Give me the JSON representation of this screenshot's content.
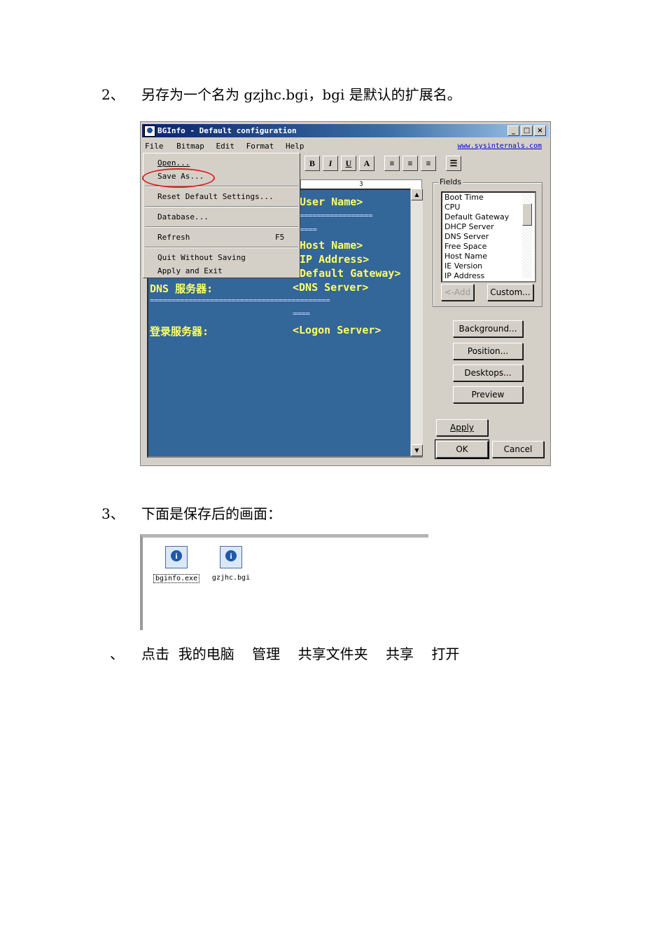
{
  "steps": [
    {
      "number": "2、",
      "text": "另存为一个名为 gzjhc.bgi，bgi 是默认的扩展名。"
    },
    {
      "number": "3、",
      "text": "下面是保存后的画面："
    },
    {
      "number": "、",
      "text": "点击  我的电脑    管理    共享文件夹    共享    打开"
    }
  ],
  "bginfo_window": {
    "title": "BGInfo - Default configuration",
    "menu": [
      "File",
      "Bitmap",
      "Edit",
      "Format",
      "Help"
    ],
    "link": "www.sysinternals.com",
    "title_buttons": [
      "_",
      "□",
      "×"
    ],
    "file_menu": [
      {
        "label": "Open...",
        "shortcut": ""
      },
      {
        "label": "Save As...",
        "shortcut": ""
      },
      {
        "label": "Reset Default Settings...",
        "shortcut": ""
      },
      {
        "label": "Database...",
        "shortcut": ""
      },
      {
        "label": "Refresh",
        "shortcut": "F5"
      },
      {
        "label": "Quit Without Saving",
        "shortcut": ""
      },
      {
        "label": "Apply and Exit",
        "shortcut": ""
      }
    ],
    "format_buttons": [
      "B",
      "I",
      "U",
      "A",
      "≡",
      "≡",
      "≡",
      "☰"
    ],
    "ruler_mark": "3",
    "editor_lines": {
      "user_name": "User Name>",
      "sep1": "=================",
      "sep2": "====",
      "host_name": "Host Name>",
      "ip_address": "IP Address>",
      "default_gateway": "Default Gateway>",
      "dns_label": "DNS 服务器:",
      "dns_value": "<DNS Server>",
      "sep3": "==========================================",
      "sep4": "====",
      "logon_label": "登录服务器:",
      "logon_value": "<Logon Server>"
    },
    "fields_label": "Fields",
    "fields": [
      "Boot Time",
      "CPU",
      "Default Gateway",
      "DHCP Server",
      "DNS Server",
      "Free Space",
      "Host Name",
      "IE Version",
      "IP Address"
    ],
    "buttons": {
      "add": "<-Add",
      "custom": "Custom...",
      "background": "Background...",
      "position": "Position...",
      "desktops": "Desktops...",
      "preview": "Preview",
      "apply": "Apply",
      "ok": "OK",
      "cancel": "Cancel"
    }
  },
  "files": [
    {
      "name": "bginfo.exe",
      "icon": "bginfo-icon"
    },
    {
      "name": "gzjhc.bgi",
      "icon": "bginfo-icon"
    }
  ]
}
